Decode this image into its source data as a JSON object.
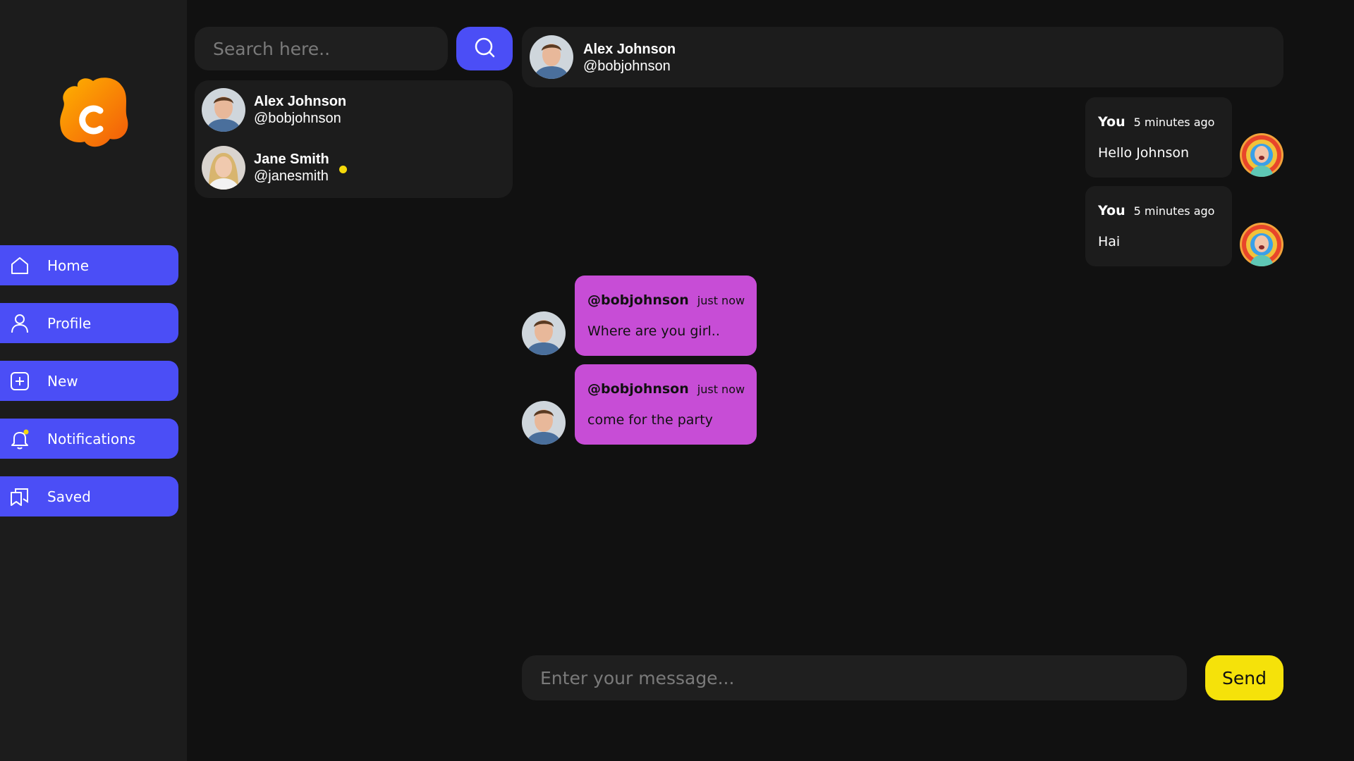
{
  "colors": {
    "background": "#111111",
    "panel": "#1c1c1c",
    "accent": "#4b4ef6",
    "incoming_bubble": "#c74dd6",
    "send_button": "#f5e20a",
    "online_dot": "#f5d90a",
    "logo": "#f5820a"
  },
  "logo": {
    "letter": "C",
    "icon": "blob-c-logo"
  },
  "sidebar": {
    "items": [
      {
        "label": "Home",
        "icon": "home-icon"
      },
      {
        "label": "Profile",
        "icon": "user-icon"
      },
      {
        "label": "New",
        "icon": "plus-square-icon"
      },
      {
        "label": "Notifications",
        "icon": "bell-icon"
      },
      {
        "label": "Saved",
        "icon": "bookmarks-icon"
      }
    ]
  },
  "search": {
    "placeholder": "Search here..",
    "icon": "search-icon"
  },
  "contacts": [
    {
      "name": "Alex Johnson",
      "handle": "@bobjohnson",
      "online": false
    },
    {
      "name": "Jane Smith",
      "handle": "@janesmith",
      "online": true
    }
  ],
  "chat_header": {
    "name": "Alex Johnson",
    "handle": "@bobjohnson"
  },
  "messages": [
    {
      "author": "You",
      "time": "5 minutes ago",
      "text": "Hello Johnson",
      "direction": "outgoing"
    },
    {
      "author": "You",
      "time": "5 minutes ago",
      "text": "Hai",
      "direction": "outgoing"
    },
    {
      "author": "@bobjohnson",
      "time": "just now",
      "text": "Where are you girl..",
      "direction": "incoming"
    },
    {
      "author": "@bobjohnson",
      "time": "just now",
      "text": "come for the party",
      "direction": "incoming"
    }
  ],
  "composer": {
    "placeholder": "Enter your message...",
    "send_label": "Send"
  }
}
